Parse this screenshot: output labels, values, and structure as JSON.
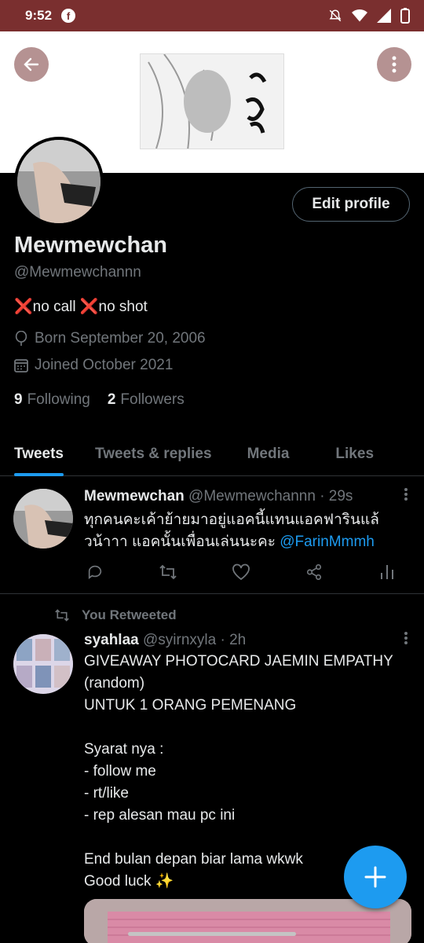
{
  "status_bar": {
    "time": "9:52",
    "app_badge": "f"
  },
  "profile": {
    "display_name": "Mewmewchan",
    "handle": "@Mewmewchannn",
    "bio": "❌no call ❌no shot",
    "born": "Born September 20, 2006",
    "joined": "Joined October 2021",
    "following_count": "9",
    "following_label": "Following",
    "followers_count": "2",
    "followers_label": "Followers",
    "edit_button": "Edit profile"
  },
  "tabs": [
    {
      "label": "Tweets",
      "active": true
    },
    {
      "label": "Tweets & replies",
      "active": false
    },
    {
      "label": "Media",
      "active": false
    },
    {
      "label": "Likes",
      "active": false
    }
  ],
  "tweets": [
    {
      "name": "Mewmewchan",
      "handle": "@Mewmewchannn",
      "time": "· 29s",
      "text": "ทุกคนคะเค้าย้ายมาอยู่แอคนี้แทนแอคฟารินแล้วน้าาา แอคนั้นเพื่อนเล่นนะคะ ",
      "mention": "@FarinMmmh"
    },
    {
      "retweet_label": "You Retweeted",
      "name": "syahlaa",
      "handle": "@syirnxyla",
      "time": "· 2h",
      "text": "GIVEAWAY PHOTOCARD JAEMIN EMPATHY (random)\nUNTUK 1 ORANG PEMENANG\n\nSyarat nya :\n- follow me\n- rt/like\n- rep alesan mau pc ini\n\nEnd bulan depan biar lama wkwk\nGood luck ✨"
    }
  ],
  "colors": {
    "accent": "#1d9bf0",
    "status_bar": "#7a2f2f",
    "background": "#000000"
  }
}
